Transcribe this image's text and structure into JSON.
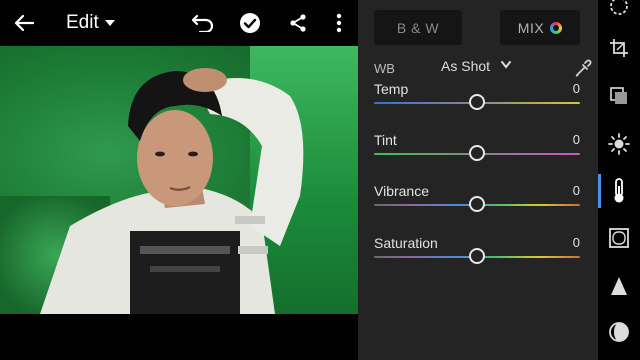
{
  "topbar": {
    "back_icon": "arrow-left-icon",
    "edit_label": "Edit",
    "edit_caret_icon": "caret-down-icon",
    "undo_icon": "undo-icon",
    "check_icon": "check-circle-icon",
    "share_icon": "share-icon",
    "more_icon": "more-vertical-icon"
  },
  "panel": {
    "bw_label": "B & W",
    "mix_label": "MIX",
    "wb_label": "WB",
    "wb_value": "As Shot",
    "sliders": [
      {
        "label": "Temp",
        "value": "0",
        "position": 0.5
      },
      {
        "label": "Tint",
        "value": "0",
        "position": 0.5
      },
      {
        "label": "Vibrance",
        "value": "0",
        "position": 0.5
      },
      {
        "label": "Saturation",
        "value": "0",
        "position": 0.5
      }
    ]
  },
  "tools": [
    "selective-icon",
    "crop-icon",
    "presets-icon",
    "light-icon",
    "color-icon",
    "effects-icon",
    "detail-icon",
    "optics-icon"
  ],
  "colors": {
    "panel_bg": "#242424",
    "active_accent": "#4a8fe8"
  }
}
